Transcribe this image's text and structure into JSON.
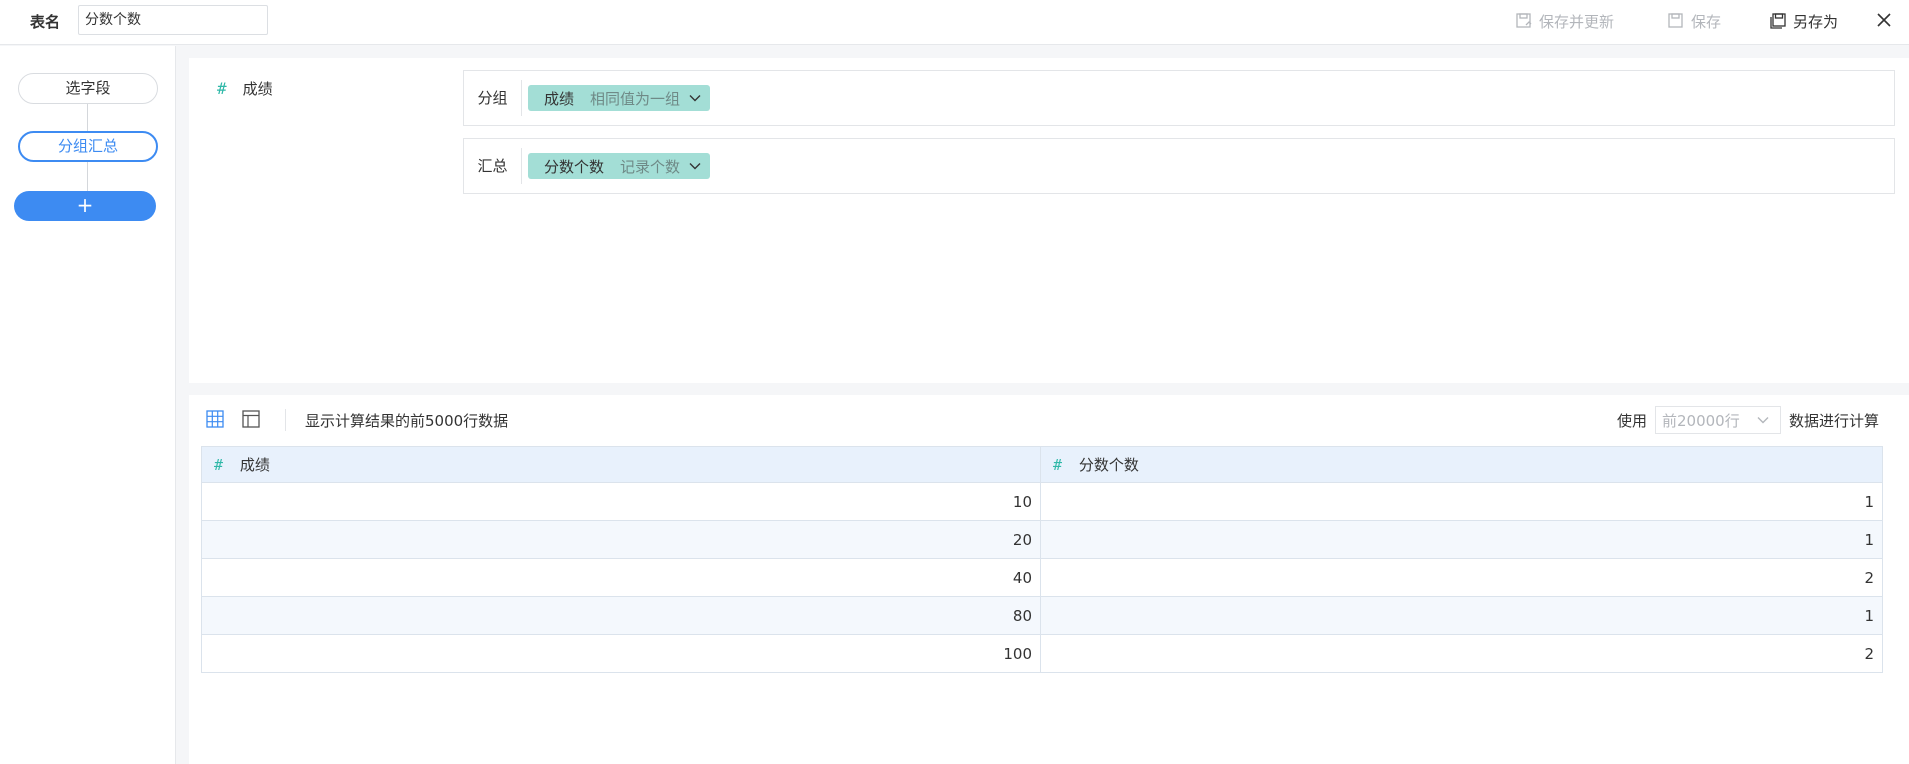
{
  "topbar": {
    "table_name_label": "表名",
    "table_name_value": "分数个数",
    "save_update_label": "保存并更新",
    "save_label": "保存",
    "save_as_label": "另存为"
  },
  "sidebar": {
    "steps": [
      {
        "label": "选字段"
      },
      {
        "label": "分组汇总"
      }
    ],
    "add_label": "+"
  },
  "config": {
    "field": {
      "label": "成绩"
    },
    "group": {
      "label": "分组",
      "chip_main": "成绩",
      "chip_sub": "相同值为一组"
    },
    "summary": {
      "label": "汇总",
      "chip_main": "分数个数",
      "chip_sub": "记录个数"
    }
  },
  "result": {
    "info": "显示计算结果的前5000行数据",
    "use_label": "使用",
    "rows_select": "前20000行",
    "calc_label": "数据进行计算",
    "columns": [
      "成绩",
      "分数个数"
    ],
    "rows": [
      [
        "10",
        "1"
      ],
      [
        "20",
        "1"
      ],
      [
        "40",
        "2"
      ],
      [
        "80",
        "1"
      ],
      [
        "100",
        "2"
      ]
    ]
  },
  "colors": {
    "accent": "#3d8bf2",
    "chip": "#a3ded6",
    "hash": "#2fb8a8",
    "header_bg": "#e8f1fc"
  }
}
